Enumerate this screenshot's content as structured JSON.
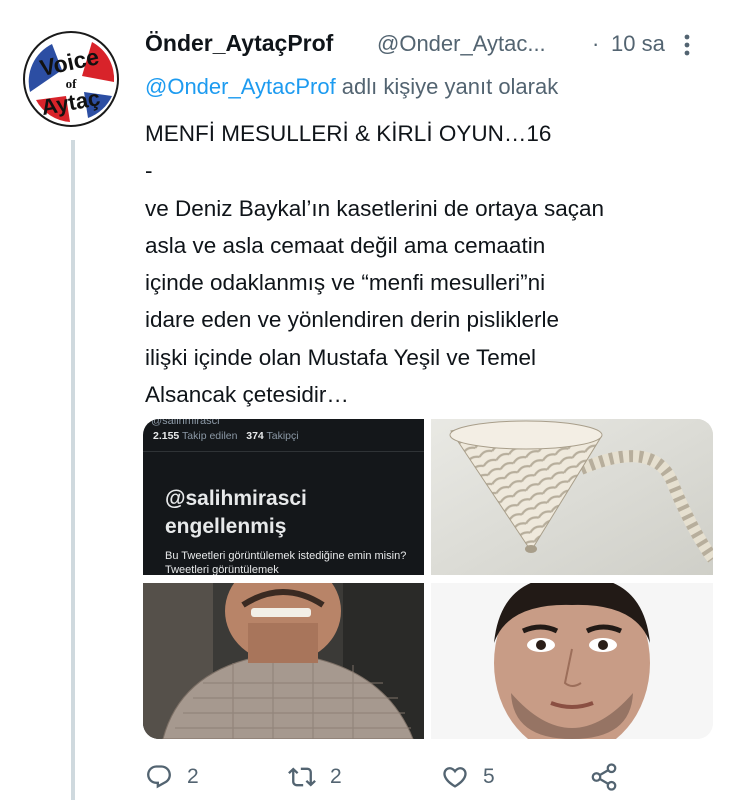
{
  "tweet": {
    "avatar": {
      "logo_lines": [
        "Voice",
        "of",
        "Aytaç"
      ],
      "colors": {
        "ring": "#1a1a1a",
        "red": "#d8232a",
        "blue": "#2c4ea3"
      }
    },
    "display_name": "Önder_AytaçProf",
    "handle": "@Onder_Aytac...",
    "separator": "·",
    "timestamp": "10 sa",
    "more_icon": "more-vertical-icon",
    "reply_context": {
      "mention": "@Onder_AytacProf",
      "suffix": " adlı kişiye yanıt olarak"
    },
    "text": "MENFİ MESULLERİ & KİRLİ OYUN…16\n-\nve Deniz Baykal’ın kasetlerini de ortaya saçan\nasla ve asla cemaat değil ama cemaatin\niçinde odaklanmış ve “menfi mesulleri”ni\nidare eden ve yönlendiren derin pisliklerle\nilişki içinde olan Mustafa Yeşil ve Temel\nAlsancak çetesidir…",
    "media": {
      "screenshot": {
        "top_handle": "@salihmirasci",
        "following_count": "2.155",
        "following_label": "Takip edilen",
        "followers_count": "374",
        "followers_label": "Takipçi",
        "blocked_handle": "@salihmirasci",
        "blocked_status": "engellenmiş",
        "confirm_text": "Bu Tweetleri görüntülemek istediğine emin misin? Tweetleri görüntülemek"
      },
      "photo_rope": "noose-rope-photo",
      "photo_man1": "man-speaking-photo",
      "photo_man2": "man-portrait-photo"
    },
    "actions": {
      "reply": {
        "icon": "reply-icon",
        "count": "2"
      },
      "retweet": {
        "icon": "retweet-icon",
        "count": "2"
      },
      "like": {
        "icon": "heart-icon",
        "count": "5"
      },
      "share": {
        "icon": "share-icon"
      }
    },
    "colors": {
      "link": "#1d9bf0",
      "muted": "#536471",
      "text": "#0f1419",
      "thread_line": "#cfd9de"
    }
  }
}
